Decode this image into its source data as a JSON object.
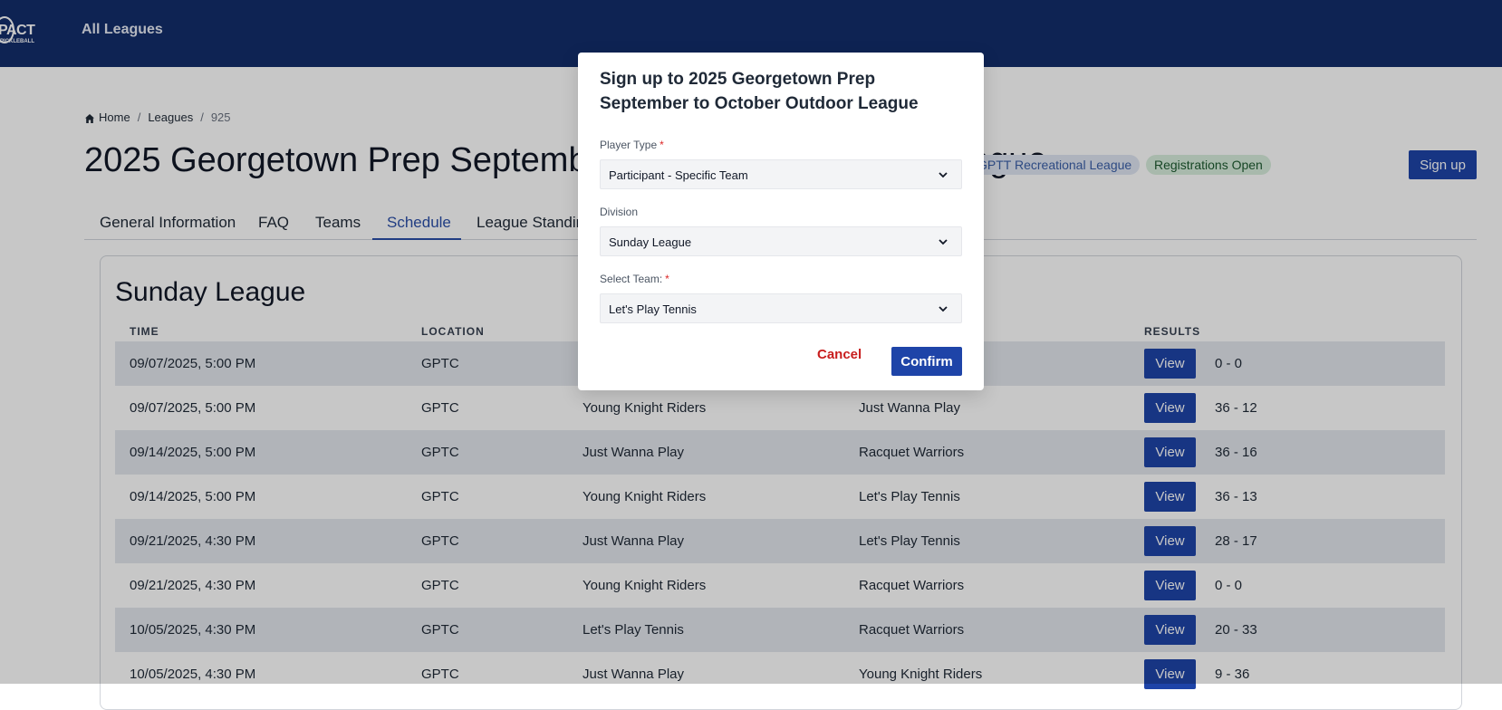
{
  "header": {
    "logo_text_main": "PACT",
    "logo_text_sub": "PICKLEBALL",
    "nav_all_leagues": "All Leagues"
  },
  "breadcrumb": {
    "home": "Home",
    "leagues": "Leagues",
    "current": "925"
  },
  "page": {
    "title": "2025 Georgetown Prep September to October Outdoor League",
    "badge_league": "GPTT Recreational League",
    "badge_status": "Registrations Open",
    "signup_label": "Sign up"
  },
  "tabs": [
    {
      "label": "General Information"
    },
    {
      "label": "FAQ"
    },
    {
      "label": "Teams"
    },
    {
      "label": "Schedule"
    },
    {
      "label": "League Standings"
    }
  ],
  "schedule": {
    "division_title": "Sunday League",
    "columns": {
      "time": "TIME",
      "location": "LOCATION",
      "results": "RESULTS"
    },
    "view_label": "View",
    "rows": [
      {
        "time": "09/07/2025, 5:00 PM",
        "location": "GPTC",
        "home": "",
        "away": "",
        "score": "0 - 0"
      },
      {
        "time": "09/07/2025, 5:00 PM",
        "location": "GPTC",
        "home": "Young Knight Riders",
        "away": "Just Wanna Play",
        "score": "36 - 12"
      },
      {
        "time": "09/14/2025, 5:00 PM",
        "location": "GPTC",
        "home": "Just Wanna Play",
        "away": "Racquet Warriors",
        "score": "36 - 16"
      },
      {
        "time": "09/14/2025, 5:00 PM",
        "location": "GPTC",
        "home": "Young Knight Riders",
        "away": "Let's Play Tennis",
        "score": "36 - 13"
      },
      {
        "time": "09/21/2025, 4:30 PM",
        "location": "GPTC",
        "home": "Just Wanna Play",
        "away": "Let's Play Tennis",
        "score": "28 - 17"
      },
      {
        "time": "09/21/2025, 4:30 PM",
        "location": "GPTC",
        "home": "Young Knight Riders",
        "away": "Racquet Warriors",
        "score": "0 - 0"
      },
      {
        "time": "10/05/2025, 4:30 PM",
        "location": "GPTC",
        "home": "Let's Play Tennis",
        "away": "Racquet Warriors",
        "score": "20 - 33"
      },
      {
        "time": "10/05/2025, 4:30 PM",
        "location": "GPTC",
        "home": "Just Wanna Play",
        "away": "Young Knight Riders",
        "score": "9 - 36"
      }
    ]
  },
  "modal": {
    "title": "Sign up to 2025 Georgetown Prep September to October Outdoor League",
    "player_type_label": "Player Type",
    "player_type_value": "Participant - Specific Team",
    "division_label": "Division",
    "division_value": "Sunday League",
    "team_label": "Select Team:",
    "team_value": "Let's Play Tennis",
    "required_mark": "*",
    "cancel_label": "Cancel",
    "confirm_label": "Confirm"
  },
  "colors": {
    "header_bg": "#122d6b",
    "primary": "#1e44a8",
    "active_tab": "#2b4fa8",
    "danger": "#c81e1e",
    "row_alt": "#e3e7ed"
  }
}
